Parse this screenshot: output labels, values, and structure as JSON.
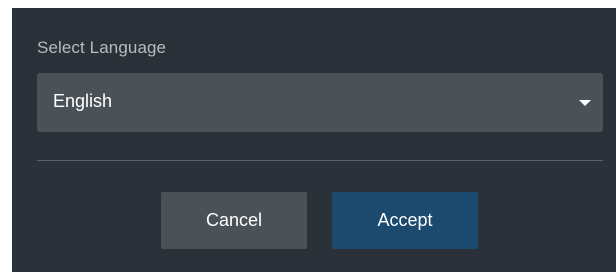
{
  "dialog": {
    "label": "Select Language",
    "language_select": {
      "selected": "English"
    },
    "buttons": {
      "cancel": "Cancel",
      "accept": "Accept"
    }
  },
  "colors": {
    "dialog_bg": "#2b3138",
    "field_bg": "#4b5257",
    "accept_bg": "#1b4a6e",
    "label_text": "#b6bcc2"
  },
  "icons": {
    "select_caret": "caret-down-icon"
  }
}
